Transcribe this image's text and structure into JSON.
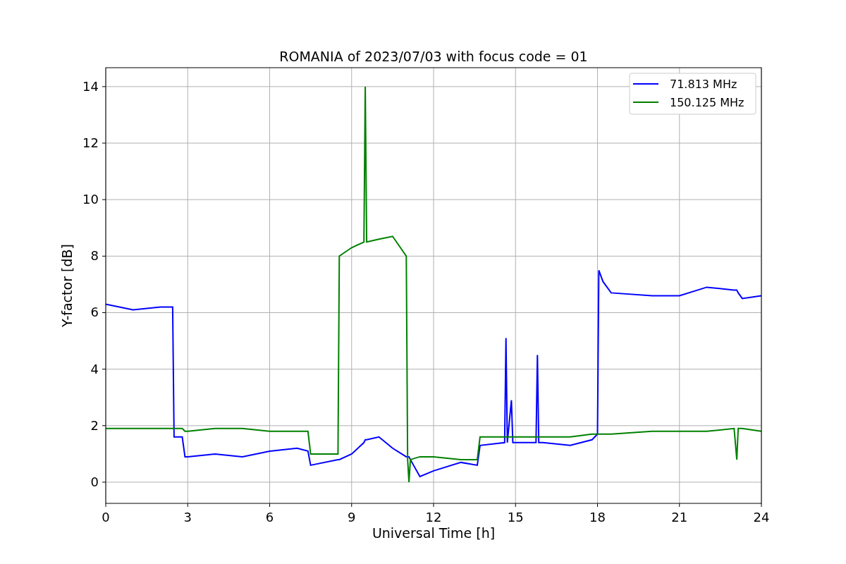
{
  "chart_data": {
    "type": "line",
    "title": "ROMANIA of 2023/07/03 with focus code = 01",
    "xlabel": "Universal Time [h]",
    "ylabel": "Y-factor [dB]",
    "x": [
      0,
      1,
      2,
      2.45,
      2.5,
      2.8,
      2.9,
      3,
      4,
      5,
      6,
      7,
      7.4,
      7.5,
      8.5,
      8.55,
      9,
      9.45,
      9.5,
      9.55,
      10,
      10.5,
      11,
      11.05,
      11.1,
      11.15,
      11.5,
      12,
      13,
      13.6,
      13.7,
      14.6,
      14.65,
      14.7,
      14.85,
      14.9,
      15.75,
      15.8,
      15.85,
      16,
      17,
      17.8,
      18,
      18.05,
      18.2,
      18.5,
      20,
      21,
      22,
      23,
      23.1,
      23.15,
      23.3,
      24
    ],
    "series": [
      {
        "name": "71.813 MHz",
        "color": "#0000ff",
        "values": [
          6.3,
          6.1,
          6.2,
          6.2,
          1.6,
          1.6,
          0.9,
          0.9,
          1.0,
          0.9,
          1.1,
          1.2,
          1.1,
          0.6,
          0.8,
          0.8,
          1.0,
          1.4,
          1.5,
          1.5,
          1.6,
          1.2,
          0.9,
          0.9,
          0.9,
          0.8,
          0.2,
          0.4,
          0.7,
          0.6,
          1.3,
          1.4,
          5.1,
          1.4,
          2.9,
          1.4,
          1.4,
          4.5,
          1.4,
          1.4,
          1.3,
          1.5,
          1.7,
          7.5,
          7.1,
          6.7,
          6.6,
          6.6,
          6.9,
          6.8,
          6.8,
          6.7,
          6.5,
          6.6
        ]
      },
      {
        "name": "150.125 MHz",
        "color": "#008000",
        "values": [
          1.9,
          1.9,
          1.9,
          1.9,
          1.9,
          1.9,
          1.8,
          1.8,
          1.9,
          1.9,
          1.8,
          1.8,
          1.8,
          1.0,
          1.0,
          8.0,
          8.3,
          8.5,
          14.0,
          8.5,
          8.6,
          8.7,
          8.0,
          0.8,
          0.0,
          0.8,
          0.9,
          0.9,
          0.8,
          0.8,
          1.6,
          1.6,
          1.6,
          1.6,
          1.6,
          1.6,
          1.6,
          1.6,
          1.6,
          1.6,
          1.6,
          1.7,
          1.7,
          1.7,
          1.7,
          1.7,
          1.8,
          1.8,
          1.8,
          1.9,
          0.8,
          1.9,
          1.9,
          1.8
        ]
      }
    ],
    "xlim": [
      0,
      24
    ],
    "ylim": [
      -0.75,
      14.67
    ],
    "xticks": [
      0,
      3,
      6,
      9,
      12,
      15,
      18,
      21,
      24
    ],
    "yticks": [
      0,
      2,
      4,
      6,
      8,
      10,
      12,
      14
    ],
    "grid": true,
    "legend": "upper right"
  }
}
